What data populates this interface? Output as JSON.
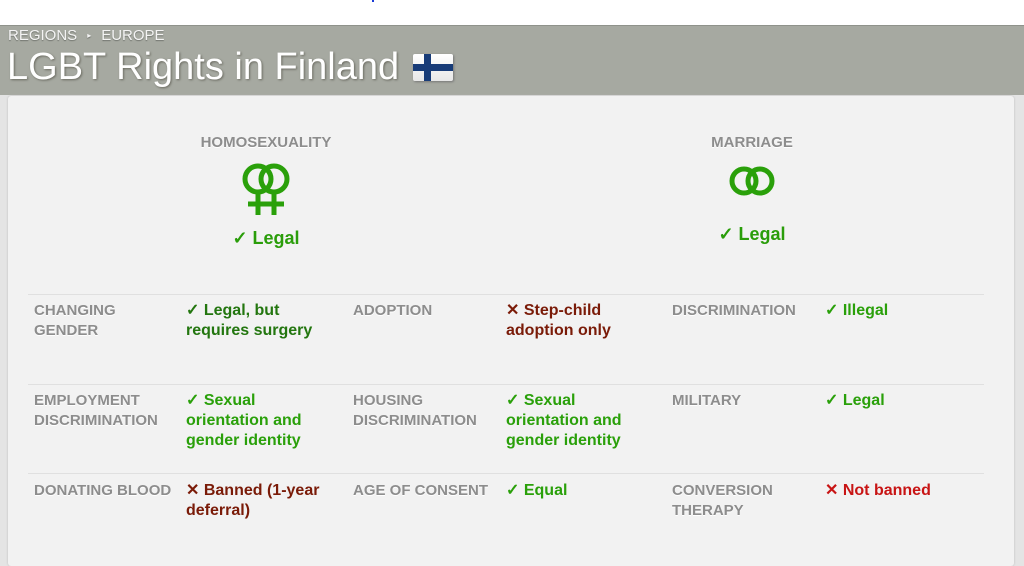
{
  "breadcrumb": {
    "items": [
      "REGIONS",
      "EUROPE"
    ],
    "separator": "▸"
  },
  "page": {
    "title": "LGBT Rights in Finland",
    "flag": "finland-flag"
  },
  "highlights": [
    {
      "title": "HOMOSEXUALITY",
      "icon": "female-couple-symbol-icon",
      "status": "✓ Legal"
    },
    {
      "title": "MARRIAGE",
      "icon": "interlocked-rings-icon",
      "status": "✓ Legal"
    }
  ],
  "rows": [
    [
      {
        "label": "CHANGING GENDER",
        "value": "✓ Legal, but requires surgery",
        "tone": "dark-green"
      },
      {
        "label": "ADOPTION",
        "value": "✕ Step-child adoption only",
        "tone": "dark-red"
      },
      {
        "label": "DISCRIMINATION",
        "value": "✓ Illegal",
        "tone": "green"
      }
    ],
    [
      {
        "label": "EMPLOYMENT DISCRIMINATION",
        "value": "✓ Sexual orientation and gender identity",
        "tone": "green"
      },
      {
        "label": "HOUSING DISCRIMINATION",
        "value": "✓ Sexual orientation and gender identity",
        "tone": "green"
      },
      {
        "label": "MILITARY",
        "value": "✓ Legal",
        "tone": "green"
      }
    ],
    [
      {
        "label": "DONATING BLOOD",
        "value": "✕ Banned (1-year deferral)",
        "tone": "dark-red"
      },
      {
        "label": "AGE OF CONSENT",
        "value": "✓ Equal",
        "tone": "green"
      },
      {
        "label": "CONVERSION THERAPY",
        "value": "✕ Not banned",
        "tone": "red"
      }
    ]
  ],
  "colors": {
    "green": "#2aa00a",
    "dark_green": "#23760f",
    "dark_red": "#7a1b08",
    "red": "#c81414",
    "header_bg": "#a6a9a1"
  }
}
